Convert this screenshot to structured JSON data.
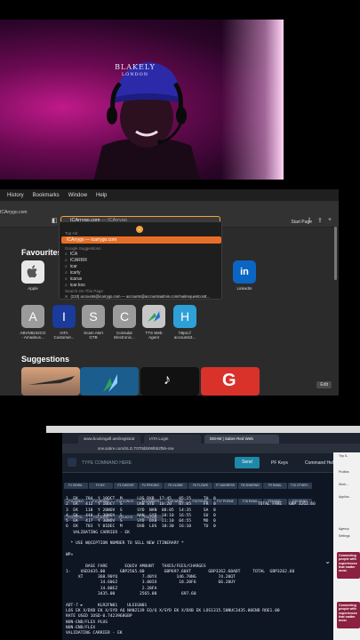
{
  "webcam": {
    "cap_line1": "BLAKELY",
    "cap_line2": "LONDON"
  },
  "safari": {
    "menu": [
      "History",
      "Bookmarks",
      "Window",
      "Help"
    ],
    "prev_url": "ICArrygo.com",
    "address": {
      "typed": "ICArrygo.com",
      "hint": " — ICArrygo"
    },
    "start_page": "Start Page",
    "dropdown": {
      "top_hit_label": "Top Hit",
      "selected": "ICArrygo — icarrygo.com",
      "suggestions_label": "Google Suggestions",
      "suggestions": [
        "ICA",
        "ICARRR",
        "icar",
        "icarly",
        "icarus",
        "icar.kos"
      ],
      "search_label": "Search On This Page",
      "email_row": "(210) accounts@icarrygo.com — accounts@accountsadmin.com/maitrequestcontt..."
    },
    "favourites_title": "Favourites",
    "favourites": [
      {
        "label": "Apple",
        "letter": "",
        "color": "#e8e8e8"
      },
      {
        "label": "LinkedIn",
        "letter": "in",
        "color": "#0a66c2"
      }
    ],
    "frequent": [
      {
        "label": "ABVN8242CG - Amadeus...",
        "letter": "A",
        "color": "#9b9b9b"
      },
      {
        "label": "IATA Customer...",
        "letter": "I",
        "color": "#1a3a9c"
      },
      {
        "label": "Scam Alert GTB",
        "letter": "S",
        "color": "#9b9b9b"
      },
      {
        "label": "Consular Electronic...",
        "letter": "C",
        "color": "#9b9b9b"
      },
      {
        "label": "TTS Web Agent",
        "letter": "",
        "color": "#c7c7c7"
      },
      {
        "label": "https:// accounts3...",
        "letter": "H",
        "color": "#2ea0d8"
      }
    ],
    "suggestions_title": "Suggestions",
    "edit": "Edit"
  },
  "sabre": {
    "tabs": [
      {
        "label": "www.bookingafl.aeti/registrat"
      },
      {
        "label": "IATA Login"
      },
      {
        "label": "DEHM | Sabre Red Web"
      }
    ],
    "url": "srw.sabre.com/SLG.T07t5bb06f6b2f5b-srw",
    "cmd_placeholder": "TYPE COMMAND HERE",
    "send": "Send",
    "pf_keys": "PF Keys",
    "command_helper": "Command Helper",
    "fkeys": [
      "F1 DEHM..",
      "F2 MY..",
      "F3 DWOOR",
      "F4 PRICING",
      "F5 GLOBE",
      "F6 FLOWS",
      "F7 ADDRESS",
      "F8 SHARING",
      "F9 EMAIL",
      "F10 OTHER..",
      "F11 CHILD",
      "F12 INFANT",
      "F13 CONCE..",
      "F14 IOREFS",
      "F15 NAME",
      "F16 RCVFL",
      "F17 PHONE",
      "F18 EMAIL",
      "F19 BAG..",
      "F20 SEND",
      "F21 PPTD..",
      "F22 DOCS",
      "F23 ADTS",
      "F24 DOB"
    ],
    "terminal": [
      "1  EK   784  Y 10OCT  M      LOS DXB  17:45   05:15     TH  0",
      "2  EK   412  Y 10OCT  S      DXB SYD  10:20   07:05     FR  0",
      "3  EK   110  Y 20NOV  S      SYD  NAN  08:05  14:35     SA  0",
      "4  EK   448  F 30NOV  S      NAN  SYD  18:10  16:55     SU  0",
      "5  EK   417  Y 30NOV  S      SYD  DXB  21:10  04:55     MO  0",
      "6  EK   783  Y 01DEC  M      DXB  LOS  10:30  16:10     TU  0",
      "   VALIDATING CARRIER - EK",
      "",
      "  * USE WQCEPTION NUMBER TO SELL NEW ITINERARY *",
      "",
      "WP»",
      "",
      "        BASE FARE       EQUIV AMOUNT   TAXES/FEES/CHARGES",
      "1-    USD3435.00      GBP2565.00        GBP697.60XT       GBP3262.60ADT     TOTAL  GBP3262.60",
      "     XT      368.90YQ          7.40YX        146.70NG         74.20QT",
      "              14.60GZ          3.00IO         18.20F6         66.20UY",
      "              14.00EZ          2.20FA",
      "             3435.00          2565.00          697.60",
      "",
      "ADT-7 ►      KLR2FN01    ULEEGN01",
      "LOS EK X/DXB EK X/SYD AQ NAN2139 EQ/Q X/SYD EK X/DXB EK LOS1315.50NUC3435.00END ROE1.00",
      "RATE USED 1USD-0.7423968GBP",
      "NON-END/FLEX PLUS",
      "NON-END/FLEX",
      "VALIDATING CARRIER - EK"
    ],
    "total_fare_label": "TOTAL FARE",
    "total_fare_value": "GBP 3262.60",
    "side_items": [
      "Trip S..",
      "Profiles",
      "Work...",
      "Applica..",
      "Agency",
      "Settings"
    ],
    "ad_text": "Connecting people with experiences that matter most."
  }
}
